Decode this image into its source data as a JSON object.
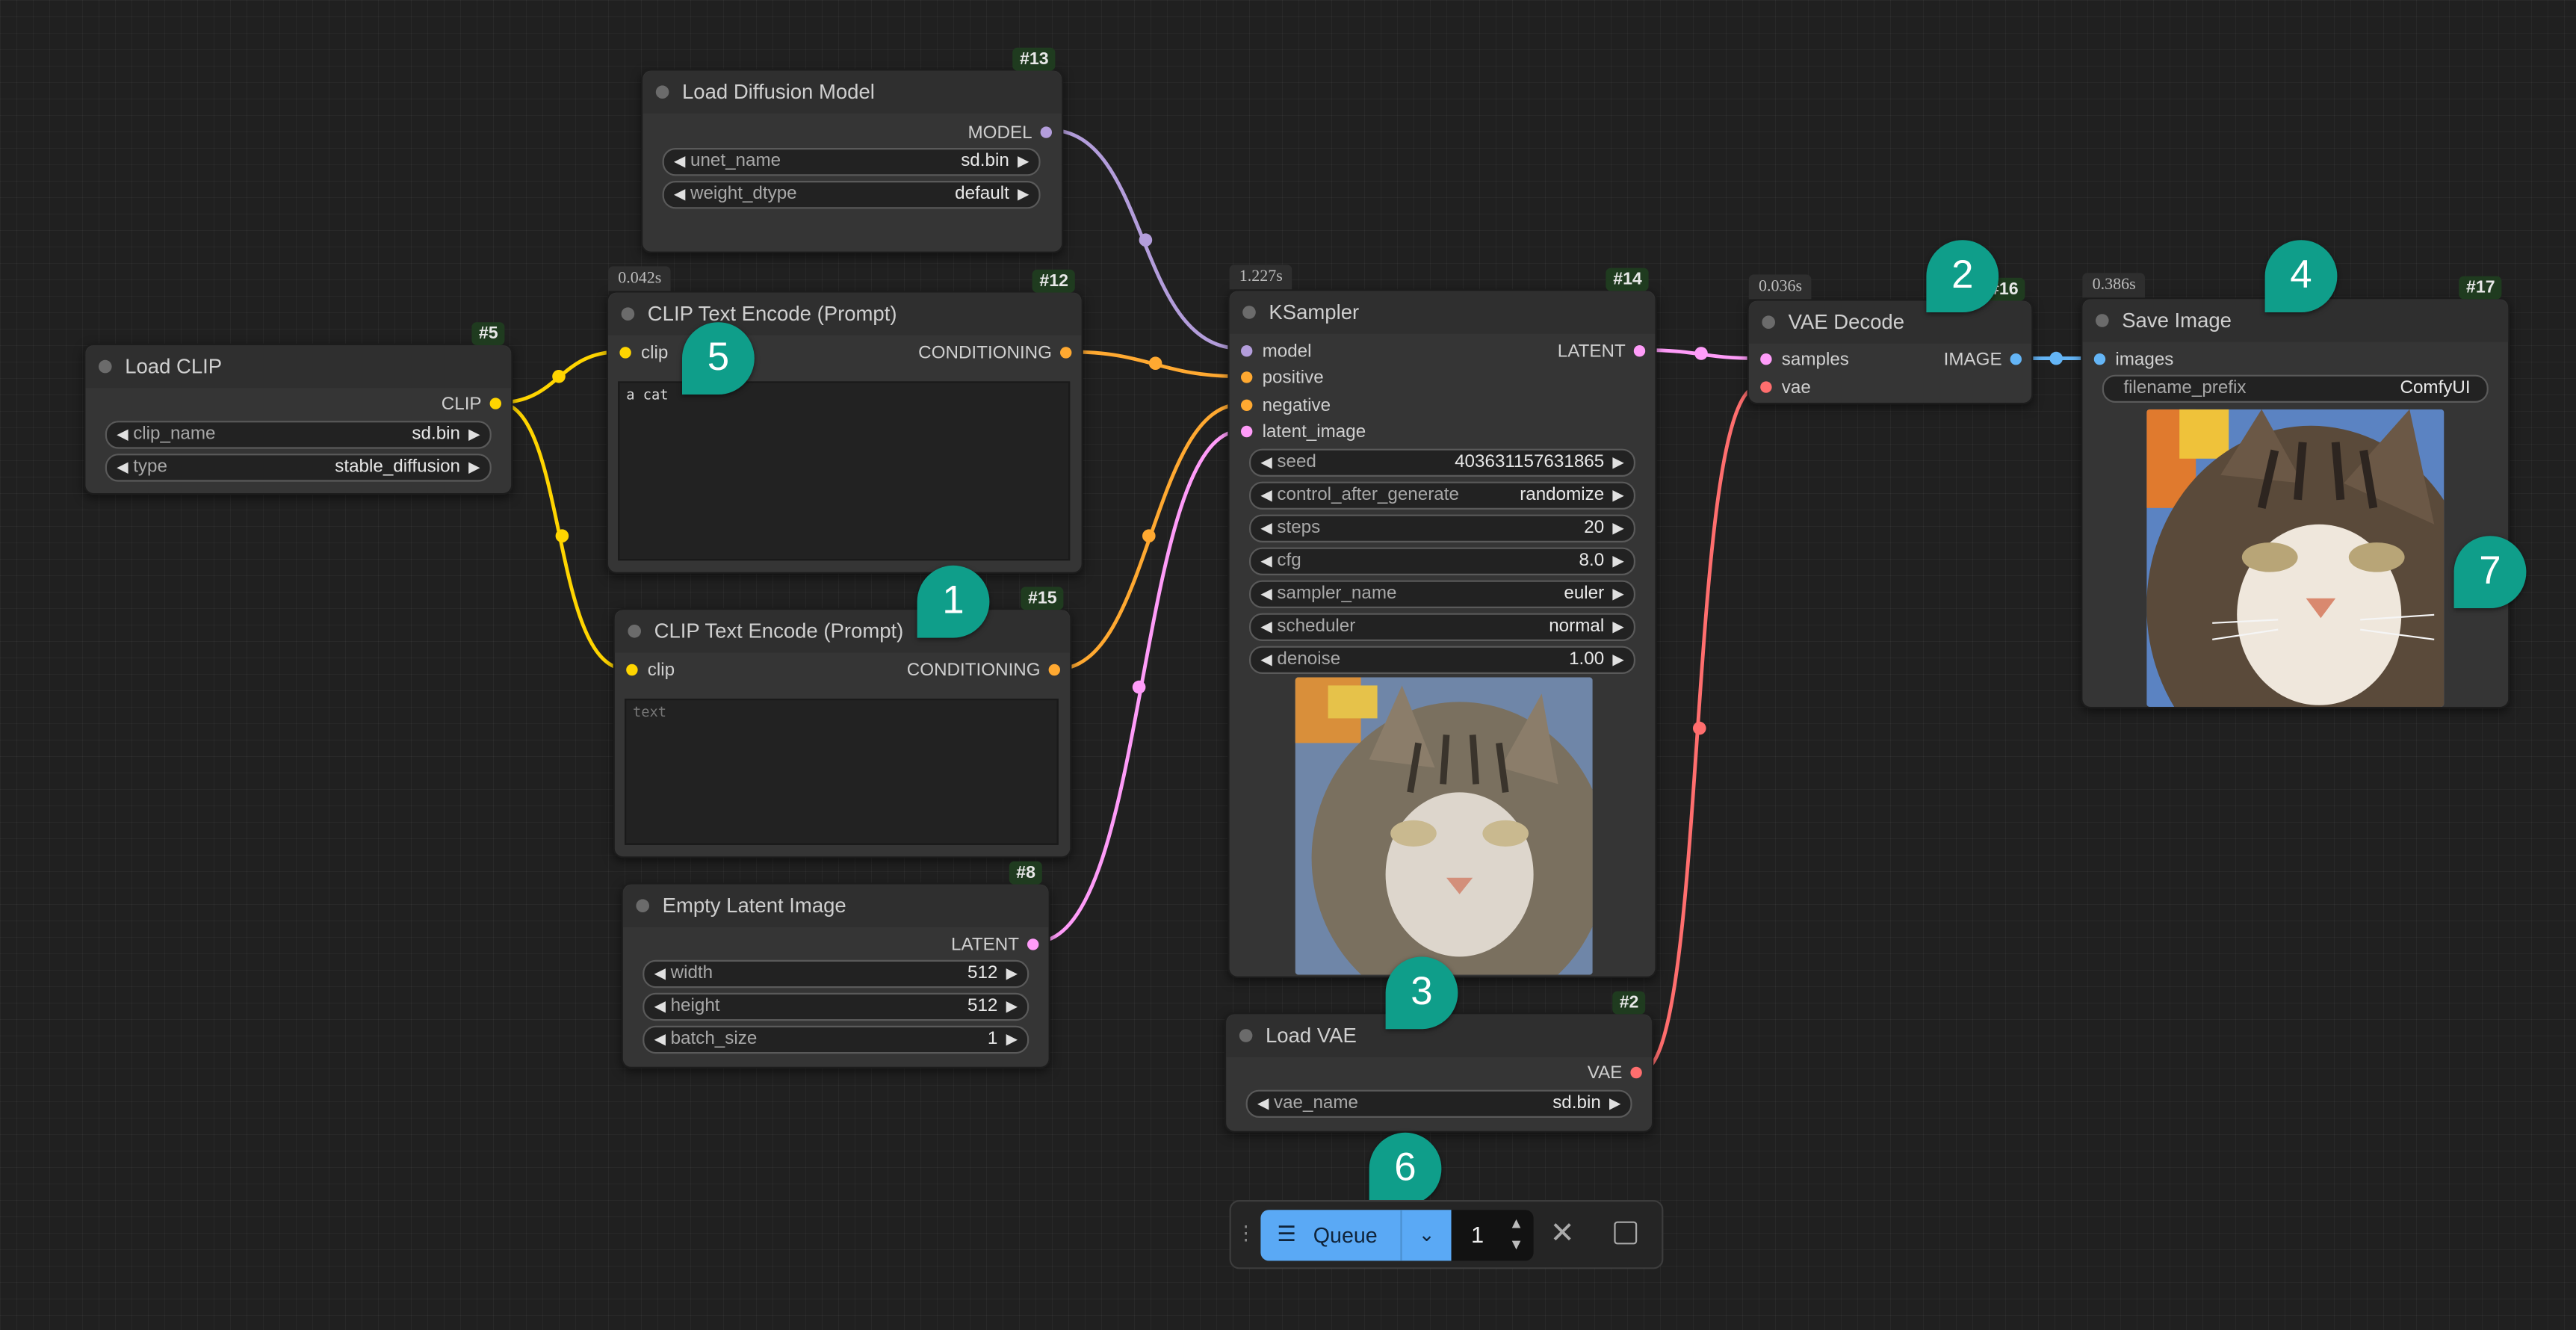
{
  "nodes": {
    "load_diffusion": {
      "id": "#13",
      "title": "Load Diffusion Model",
      "out": "MODEL",
      "widgets": [
        {
          "name": "unet_name",
          "value": "sd.bin"
        },
        {
          "name": "weight_dtype",
          "value": "default"
        }
      ]
    },
    "clip_encode_pos": {
      "id": "#12",
      "time": "0.042s",
      "title": "CLIP Text Encode (Prompt)",
      "in": "clip",
      "out": "CONDITIONING",
      "text": "a cat"
    },
    "load_clip": {
      "id": "#5",
      "title": "Load CLIP",
      "out": "CLIP",
      "widgets": [
        {
          "name": "clip_name",
          "value": "sd.bin"
        },
        {
          "name": "type",
          "value": "stable_diffusion"
        }
      ]
    },
    "clip_encode_neg": {
      "id": "#15",
      "title": "CLIP Text Encode (Prompt)",
      "in": "clip",
      "out": "CONDITIONING",
      "placeholder": "text"
    },
    "empty_latent": {
      "id": "#8",
      "title": "Empty Latent Image",
      "out": "LATENT",
      "widgets": [
        {
          "name": "width",
          "value": "512"
        },
        {
          "name": "height",
          "value": "512"
        },
        {
          "name": "batch_size",
          "value": "1"
        }
      ]
    },
    "ksampler": {
      "id": "#14",
      "time": "1.227s",
      "title": "KSampler",
      "out": "LATENT",
      "inputs": [
        "model",
        "positive",
        "negative",
        "latent_image"
      ],
      "widgets": [
        {
          "name": "seed",
          "value": "403631157631865"
        },
        {
          "name": "control_after_generate",
          "value": "randomize"
        },
        {
          "name": "steps",
          "value": "20"
        },
        {
          "name": "cfg",
          "value": "8.0"
        },
        {
          "name": "sampler_name",
          "value": "euler"
        },
        {
          "name": "scheduler",
          "value": "normal"
        },
        {
          "name": "denoise",
          "value": "1.00"
        }
      ]
    },
    "load_vae": {
      "id": "#2",
      "title": "Load VAE",
      "out": "VAE",
      "widgets": [
        {
          "name": "vae_name",
          "value": "sd.bin"
        }
      ]
    },
    "vae_decode": {
      "id": "#16",
      "time": "0.036s",
      "title": "VAE Decode",
      "inputs": [
        "samples",
        "vae"
      ],
      "out": "IMAGE"
    },
    "save_image": {
      "id": "#17",
      "time": "0.386s",
      "title": "Save Image",
      "in": "images",
      "widgets": [
        {
          "name": "filename_prefix",
          "value": "ComfyUI"
        }
      ]
    }
  },
  "bubbles": [
    "1",
    "2",
    "3",
    "4",
    "5",
    "6",
    "7"
  ],
  "queue": {
    "label": "Queue",
    "count": "1"
  },
  "colors": {
    "model": "#b39ddb",
    "clip": "#ffd500",
    "conditioning": "#ffa931",
    "latent": "#ff9cf9",
    "vae": "#ff6e6e",
    "image": "#64b5f6",
    "bubble": "#0f9e8a"
  }
}
